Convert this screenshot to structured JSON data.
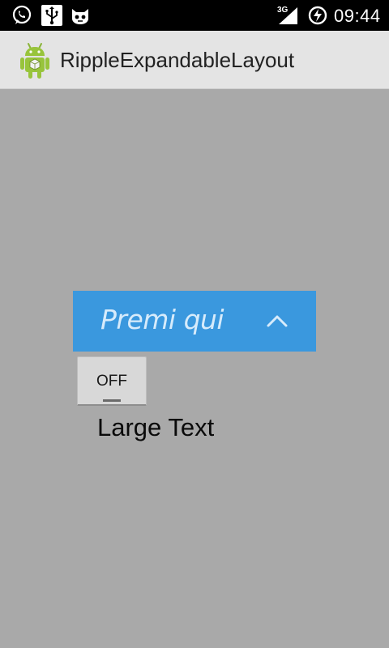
{
  "status_bar": {
    "network_type": "3G",
    "time": "09:44",
    "icons": [
      "whatsapp-icon",
      "usb-icon",
      "cat-icon",
      "signal-icon",
      "battery-charging-icon"
    ]
  },
  "action_bar": {
    "app_icon": "android-icon",
    "title": "RippleExpandableLayout"
  },
  "content": {
    "ripple_header": {
      "label": "Premi qui",
      "icon": "chevron-up-icon",
      "background": "#3a98de"
    },
    "toggle_button": {
      "label": "OFF",
      "state": "off"
    },
    "large_text": "Large Text"
  },
  "colors": {
    "status_bar": "#000000",
    "action_bar": "#e4e4e4",
    "content_background": "#a9a9a9",
    "accent": "#3a98de"
  }
}
